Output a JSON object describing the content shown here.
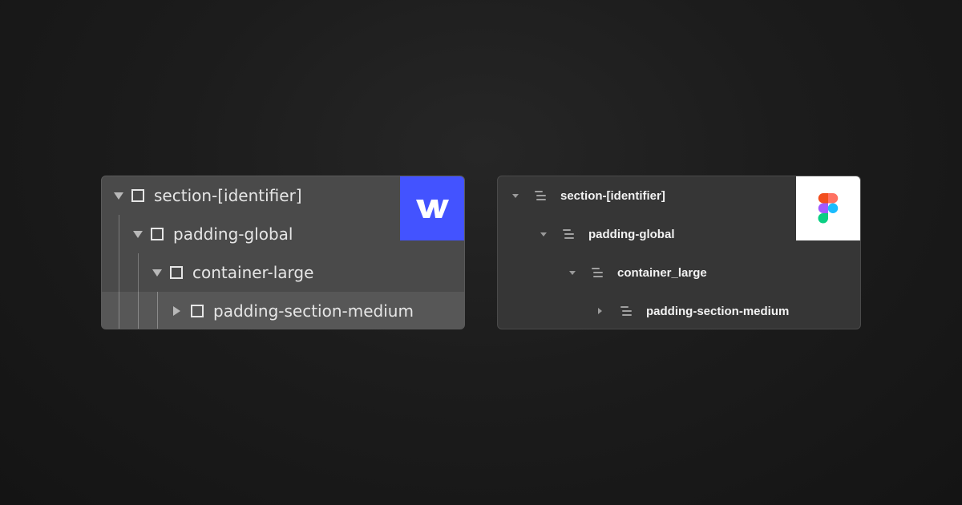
{
  "webflow": {
    "logo_icon": "webflow-logo-icon",
    "brand_color": "#4353ff",
    "rows": [
      {
        "label": "section-[identifier]",
        "expanded": true
      },
      {
        "label": "padding-global",
        "expanded": true
      },
      {
        "label": "container-large",
        "expanded": true
      },
      {
        "label": "padding-section-medium",
        "expanded": false
      }
    ]
  },
  "figma": {
    "logo_icon": "figma-logo-icon",
    "logo_colors": [
      "#f24e1e",
      "#ff7262",
      "#a259ff",
      "#1abcfe",
      "#0acf83"
    ],
    "rows": [
      {
        "label": "section-[identifier]",
        "expanded": true
      },
      {
        "label": "padding-global",
        "expanded": true
      },
      {
        "label": "container_large",
        "expanded": true
      },
      {
        "label": "padding-section-medium",
        "expanded": false
      }
    ]
  }
}
